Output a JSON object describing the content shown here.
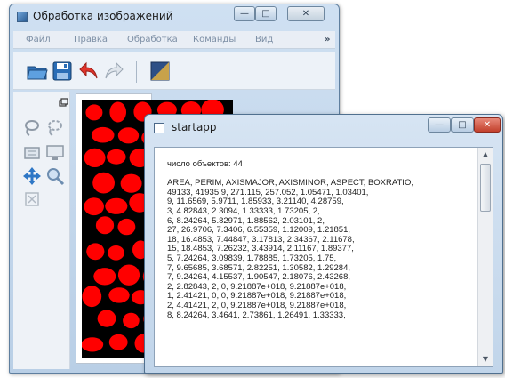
{
  "main_window": {
    "title": "Обработка изображений",
    "controls": {
      "minimize": "—",
      "maximize": "□",
      "close": "✕"
    },
    "menu": [
      "Файл",
      "Правка",
      "Обработка",
      "Команды",
      "Вид",
      "»"
    ]
  },
  "console_window": {
    "title": "startapp",
    "controls": {
      "minimize": "—",
      "maximize": "□",
      "close": "✕"
    },
    "lines": [
      "число объектов: 44",
      "",
      "AREA, PERIM, AXISMAJOR, AXISMINOR, ASPECT, BOXRATIO,",
      "49133, 41935.9, 271.115, 257.052, 1.05471, 1.03401,",
      "9, 11.6569, 5.9711, 1.85933, 3.21140, 4.28759,",
      "3, 4.82843, 2.3094, 1.33333, 1.73205, 2,",
      "6, 8.24264, 5.82971, 1.88562, 2.03101, 2,",
      "27, 26.9706, 7.3406, 6.55359, 1.12009, 1.21851,",
      "18, 16.4853, 7.44847, 3.17813, 2.34367, 2.11678,",
      "15, 18.4853, 7.26232, 3.43914, 2.11167, 1.89377,",
      "5, 7.24264, 3.09839, 1.78885, 1.73205, 1.75,",
      "7, 9.65685, 3.68571, 2.82251, 1.30582, 1.29284,",
      "7, 9.24264, 4.15537, 1.90547, 2.18076, 2.43268,",
      "2, 2.82843, 2, 0, 9.21887e+018, 9.21887e+018,",
      "1, 2.41421, 0, 0, 9.21887e+018, 9.21887e+018,",
      "2, 4.41421, 2, 0, 9.21887e+018, 9.21887e+018,",
      "8, 8.24264, 3.4641, 2.73861, 1.26491, 1.33333,"
    ]
  },
  "colors": {
    "blob_red": "#ff0000",
    "canvas_bg": "#000000",
    "close_button": "#c2402c"
  },
  "icons": {
    "toolbar": [
      "folder-open-icon",
      "save-icon",
      "undo-icon",
      "redo-icon",
      "image-icon"
    ],
    "tools": [
      "lasso-icon",
      "lasso-alt-icon",
      "rectangle-select-icon",
      "monitor-icon",
      "move-icon",
      "zoom-icon",
      "crop-icon"
    ]
  }
}
